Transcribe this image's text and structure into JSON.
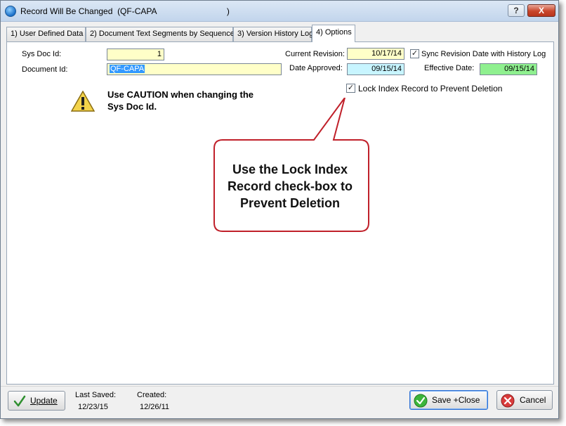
{
  "window": {
    "title": "Record Will Be Changed  (QF-CAPA                              )",
    "help_label": "?",
    "close_label": "X"
  },
  "tabs": [
    {
      "label": "1) User Defined Data"
    },
    {
      "label": "2) Document Text Segments by Sequence"
    },
    {
      "label": "3) Version History Log"
    },
    {
      "label": "4) Options",
      "active": true
    }
  ],
  "form": {
    "sys_doc_id_label": "Sys Doc Id:",
    "sys_doc_id_value": "1",
    "document_id_label": "Document Id:",
    "document_id_value": "QF-CAPA",
    "current_revision_label": "Current Revision:",
    "current_revision_value": "10/17/14",
    "sync_label": "Sync Revision Date with History Log",
    "sync_checked": true,
    "date_approved_label": "Date Approved:",
    "date_approved_value": "09/15/14",
    "effective_date_label": "Effective Date:",
    "effective_date_value": "09/15/14",
    "lock_label": "Lock Index Record to Prevent Deletion",
    "lock_checked": true
  },
  "warning": {
    "line1": "Use CAUTION when changing the",
    "line2": "Sys Doc Id."
  },
  "callout": {
    "line1": "Use the Lock Index",
    "line2": "Record check-box to",
    "line3": "Prevent Deletion"
  },
  "footer": {
    "update_label": "Update",
    "last_saved_label": "Last Saved:",
    "last_saved_value": "12/23/15",
    "created_label": "Created:",
    "created_value": "12/26/11",
    "save_close_label": "Save +Close",
    "cancel_label": "Cancel"
  },
  "icons": {
    "app": "app-globe-icon",
    "warning": "warning-icon",
    "update": "checkmark-icon",
    "save": "green-check-icon",
    "cancel": "red-x-icon",
    "check_mark": "✓"
  },
  "colors": {
    "yellow_field": "#ffffc8",
    "cyan_field": "#c8f5ff",
    "green_field": "#8ff08f",
    "callout_border": "#c0202a",
    "close_button": "#c9462c"
  }
}
